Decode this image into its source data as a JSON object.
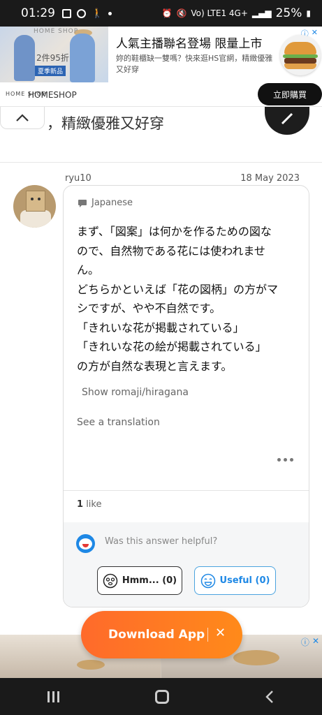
{
  "status_bar": {
    "time": "01:29",
    "battery": "25%",
    "network": "Vo) LTE1 4G+"
  },
  "ad_top": {
    "title": "人氣主播聯名登場 限量上市",
    "description": "妳的鞋櫃缺一雙嗎？快來逛HS官網，精緻優雅又好穿",
    "brand_logo": "HOME SHOP",
    "brand_name": "HOMESHOP",
    "thumb_brand": "HOME SHOP",
    "thumb_tag": "夏季新品",
    "thumb_price": "2件95折",
    "cta": "立即購買"
  },
  "previous_answer": {
    "snippet": "，精緻優雅又好穿"
  },
  "answer": {
    "username": "ryu10",
    "date": "18 May 2023",
    "language": "Japanese",
    "text_lines": [
      "まず、「図案」は何かを作るための図な",
      "ので、自然物である花には使われませ",
      "ん。",
      "どちらかといえば「花の図柄」の方がマ",
      "シですが、やや不自然です。",
      "「きれいな花が掲載されている」",
      "「きれいな花の絵が掲載されている」",
      "の方が自然な表現と言えます。"
    ],
    "show_romaji": "Show romaji/hiragana",
    "see_translation": "See a translation",
    "like_count": "1",
    "like_label": "like",
    "helpful_question": "Was this answer helpful?",
    "hmm_button": "Hmm... (0)",
    "useful_button": "Useful (0)"
  },
  "download_app": {
    "label": "Download App",
    "close": "✕"
  },
  "icons": {
    "collapse": "chevron-up-icon",
    "language": "speech-bubble-icon",
    "more": "more-options-icon",
    "hmm": "neutral-face-icon",
    "useful": "smile-face-icon"
  },
  "colors": {
    "accent_blue": "#1e88e5",
    "download_gradient_start": "#ff6a2b",
    "download_gradient_end": "#ff8a1a"
  }
}
